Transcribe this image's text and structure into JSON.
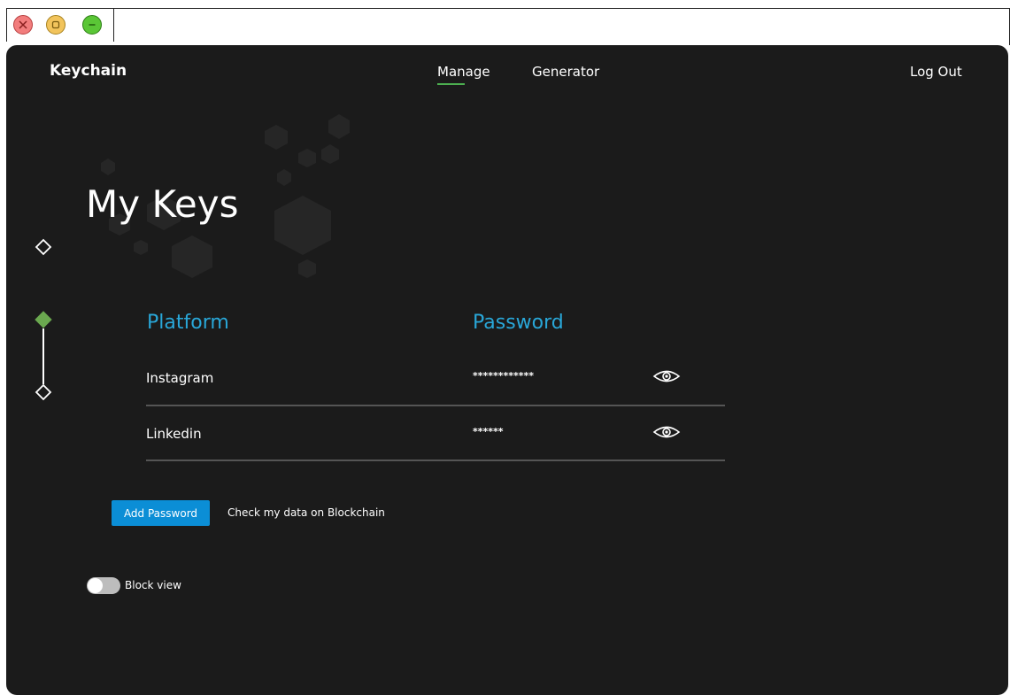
{
  "window_controls": {
    "close_icon": "close-icon",
    "maximize_icon": "maximize-icon",
    "minimize_icon": "minimize-icon"
  },
  "header": {
    "brand": "Keychain",
    "nav": {
      "manage": "Manage",
      "generator": "Generator",
      "active": "Manage"
    },
    "logout": "Log Out"
  },
  "page_title": "My Keys",
  "stepper": {
    "steps": 3,
    "active_step": 2
  },
  "table": {
    "headers": {
      "platform": "Platform",
      "password": "Password"
    },
    "rows": [
      {
        "platform": "Instagram",
        "password_mask": "************",
        "reveal_icon": "eye-icon"
      },
      {
        "platform": "Linkedin",
        "password_mask": "******",
        "reveal_icon": "eye-icon"
      }
    ]
  },
  "actions": {
    "add_password": "Add Password",
    "check_blockchain": "Check my data on Blockchain"
  },
  "block_view": {
    "label": "Block view",
    "enabled": false
  },
  "colors": {
    "background": "#1b1b1b",
    "accent_blue": "#29a7d8",
    "button_blue": "#0b8ed6",
    "active_green": "#4caf50",
    "stepper_green": "#6aa84f"
  }
}
